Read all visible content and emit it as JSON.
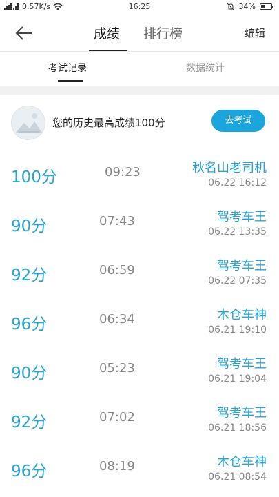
{
  "status": {
    "network": "0.57K/s",
    "time": "16:25",
    "battery": "34%",
    "battery_level": 0.34
  },
  "header": {
    "tab_scores": "成绩",
    "tab_ranking": "排行榜",
    "edit": "编辑"
  },
  "subtabs": {
    "exam_records": "考试记录",
    "statistics": "数据统计"
  },
  "best": {
    "text": "您的历史最高成绩100分",
    "button": "去考试"
  },
  "records": [
    {
      "score": "100分",
      "duration": "09:23",
      "user": "秋名山老司机",
      "datetime": "06.22  16:12"
    },
    {
      "score": "90分",
      "duration": "07:43",
      "user": "驾考车王",
      "datetime": "06.22  13:35"
    },
    {
      "score": "92分",
      "duration": "06:59",
      "user": "驾考车王",
      "datetime": "06.22  07:35"
    },
    {
      "score": "96分",
      "duration": "06:34",
      "user": "木仓车神",
      "datetime": "06.21  19:10"
    },
    {
      "score": "90分",
      "duration": "05:23",
      "user": "驾考车王",
      "datetime": "06.21  19:04"
    },
    {
      "score": "92分",
      "duration": "07:02",
      "user": "驾考车王",
      "datetime": "06.21  18:56"
    },
    {
      "score": "96分",
      "duration": "08:19",
      "user": "木仓车神",
      "datetime": "06.21  08:54"
    }
  ],
  "colors": {
    "accent": "#27a4d2",
    "button": "#1aa6dc"
  }
}
